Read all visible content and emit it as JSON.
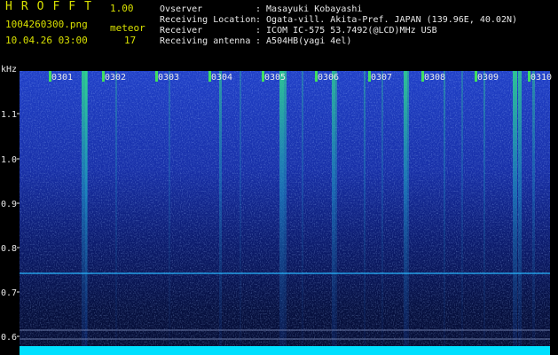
{
  "header": {
    "app_name": "HROFFT",
    "version": "1.00",
    "filename": "1004260300.png",
    "datetime": "10.04.26 03:00",
    "meteor_label": "meteor",
    "meteor_count": "17",
    "info_labels": [
      "Ovserver",
      "Receiving Location",
      "Receiver",
      "Receiving antenna"
    ],
    "info_values": [
      ": Masayuki Kobayashi",
      ": Ogata-vill. Akita-Pref. JAPAN (139.96E, 40.02N)",
      ": ICOM IC-575 53.7492(@LCD)MHz USB",
      ": A504HB(yagi 4el)"
    ]
  },
  "spectrogram": {
    "y_unit": "kHz",
    "y_ticks": [
      "1.1",
      "1.0",
      "0.9",
      "0.8",
      "0.7",
      "0.6"
    ],
    "time_ticks": [
      "0301",
      "0302",
      "0303",
      "0304",
      "0305",
      "0306",
      "0307",
      "0308",
      "0309",
      "0310"
    ],
    "colors": {
      "background": "#000000",
      "noise": "#1a3cc8",
      "strong": "#30e080",
      "axis_text": "#e8e8e8",
      "header_yellow": "#d8e000",
      "baseline": "#00e8ff"
    }
  }
}
